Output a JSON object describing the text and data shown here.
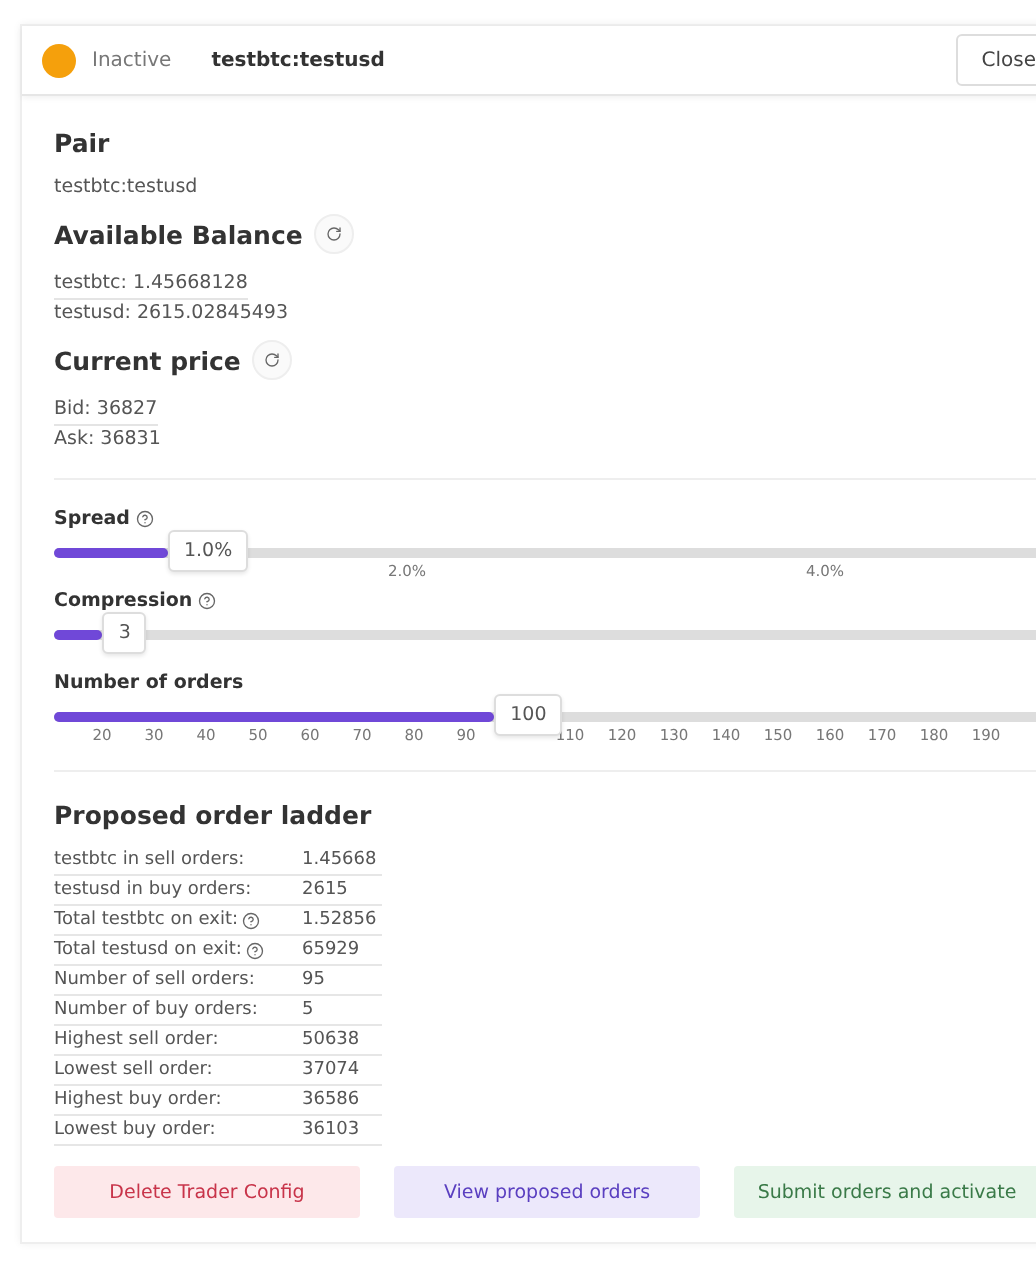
{
  "header": {
    "active": false,
    "status": "Inactive",
    "pair": "testbtc:testusd",
    "close": "Close"
  },
  "pair": {
    "title": "Pair",
    "value": "testbtc:testusd"
  },
  "balance": {
    "title": "Available Balance",
    "lines": [
      "testbtc:  1.45668128",
      "testusd: 2615.02845493"
    ]
  },
  "price": {
    "title": "Current price",
    "lines": [
      "Bid:  36827",
      "Ask: 36831"
    ]
  },
  "spread": {
    "label": "Spread",
    "help": true,
    "level": 0.11,
    "value": "1.0%",
    "marks": [
      "2.0%",
      "4.0%"
    ]
  },
  "compression": {
    "label": "Compression",
    "help": true,
    "level": 0.047,
    "value": "3"
  },
  "orders": {
    "label": "Number of orders",
    "help": false,
    "level": 0.425,
    "value": "100",
    "marks_before_thumb": [
      "20",
      "30",
      "40",
      "50",
      "60",
      "70",
      "80",
      "90"
    ],
    "marks_after_thumb": [
      "110",
      "120",
      "130",
      "140",
      "150",
      "160",
      "170",
      "180",
      "190"
    ]
  },
  "ladder": {
    "title": "Proposed order ladder",
    "rows": [
      {
        "label": "testbtc in sell orders:",
        "help": false,
        "value": "1.45668"
      },
      {
        "label": "testusd in buy orders:",
        "help": false,
        "value": "2615"
      },
      {
        "label": "Total testbtc on exit:",
        "help": true,
        "value": "1.52856"
      },
      {
        "label": "Total testusd on exit:",
        "help": true,
        "value": "65929"
      },
      {
        "label": "Number of sell orders:",
        "help": false,
        "value": "95"
      },
      {
        "label": "Number of buy orders:",
        "help": false,
        "value": "5"
      },
      {
        "label": "Highest sell order:",
        "help": false,
        "value": "50638"
      },
      {
        "label": "Lowest sell order:",
        "help": false,
        "value": "37074"
      },
      {
        "label": "Highest buy order:",
        "help": false,
        "value": "36586"
      },
      {
        "label": "Lowest buy order:",
        "help": false,
        "value": "36103"
      }
    ]
  },
  "buttons": [
    {
      "label": "Delete Trader Config",
      "kind": "danger"
    },
    {
      "label": "View proposed orders",
      "kind": "primary"
    },
    {
      "label": "Submit orders and activate",
      "kind": "success"
    }
  ]
}
